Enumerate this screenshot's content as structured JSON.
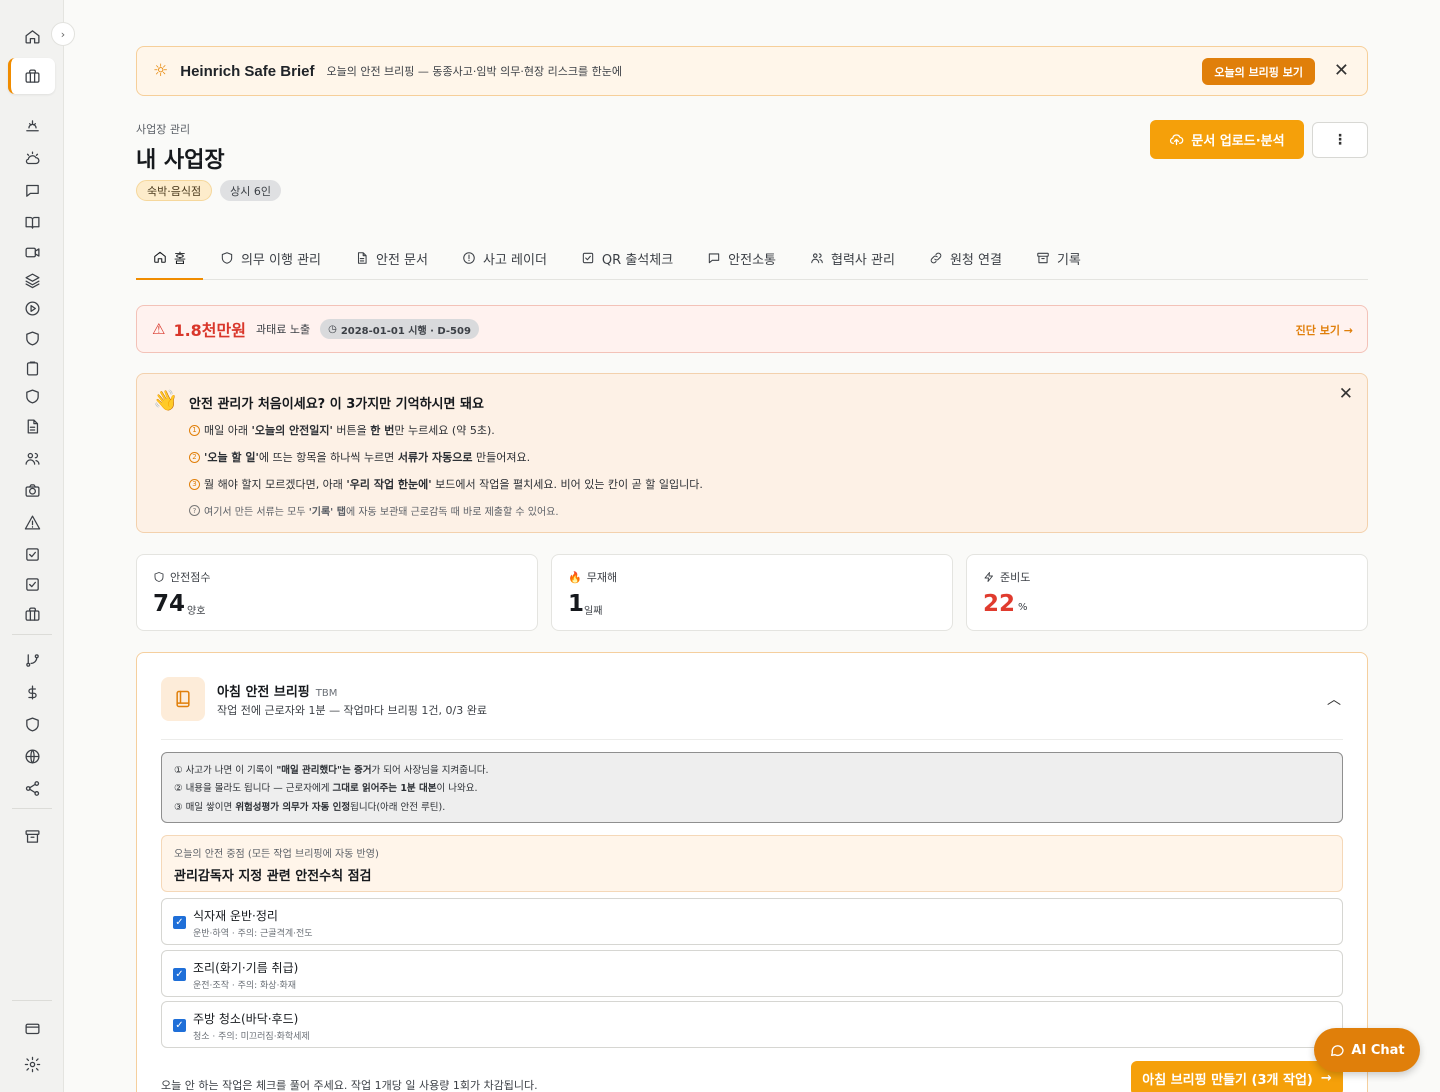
{
  "brief": {
    "title": "Heinrich Safe Brief",
    "description": "오늘의 안전 브리핑 — 동종사고·임박 의무·현장 리스크를 한눈에",
    "button": "오늘의 브리핑 보기",
    "close": "✕"
  },
  "header": {
    "breadcrumb": "사업장 관리",
    "title": "내 사업장",
    "tags": [
      "숙박·음식점",
      "상시 6인"
    ],
    "upload_button": "문서 업로드·분석",
    "more": "⋮"
  },
  "tabs": [
    "홈",
    "의무 이행 관리",
    "안전 문서",
    "사고 레이더",
    "QR 출석체크",
    "안전소통",
    "협력사 관리",
    "원청 연결",
    "기록"
  ],
  "penalty": {
    "amount": "1.8천만원",
    "label": "과태료 노출",
    "date_pill": "2028-01-01 시행 · D-509",
    "link": "진단 보기 →"
  },
  "onboarding": {
    "title": "안전 관리가 처음이세요? 이 3가지만 기억하시면 돼요",
    "steps": [
      {
        "num": "1",
        "pre": "매일 아래 ",
        "b1": "'오늘의 안전일지'",
        "mid": " 버튼을 ",
        "b2": "한 번",
        "post": "만 누르세요 (약 5초)."
      },
      {
        "num": "2",
        "pre": "",
        "b1": "'오늘 할 일'",
        "mid": "에 뜨는 항목을 하나씩 누르면 ",
        "b2": "서류가 자동으로",
        "post": " 만들어져요."
      },
      {
        "num": "3",
        "pre": "뭘 해야 할지 모르겠다면, 아래 ",
        "b1": "'우리 작업 한눈에'",
        "mid": " 보드에서 작업을 펼치세요. 비어 있는 칸이 곧 할 일입니다.",
        "b2": "",
        "post": ""
      }
    ],
    "note": {
      "num": "?",
      "pre": "여기서 만든 서류는 모두 ",
      "b1": "'기록' 탭",
      "post": "에 자동 보관돼 근로감독 때 바로 제출할 수 있어요."
    }
  },
  "stats": [
    {
      "label": "안전점수",
      "value": "74",
      "unit": "양호",
      "color": "#16191d"
    },
    {
      "label": "무재해",
      "value": "1",
      "unit": "일째",
      "color": "#16191d"
    },
    {
      "label": "준비도",
      "value": "22",
      "unit": "%",
      "color": "#e03b2e"
    }
  ],
  "tbm": {
    "title": "아침 안전 브리핑",
    "code": "TBM",
    "subtitle": "작업 전에 근로자와 1분 — 작업마다 브리핑 1건, 0/3 완료",
    "info": [
      {
        "num": "①",
        "pre": "사고가 나면 이 기록이 ",
        "b": "\"매일 관리했다\"는 증거",
        "post": "가 되어 사장님을 지켜줍니다."
      },
      {
        "num": "②",
        "pre": "내용을 몰라도 됩니다 — 근로자에게 ",
        "b": "그대로 읽어주는 1분 대본",
        "post": "이 나와요."
      },
      {
        "num": "③",
        "pre": "매일 쌓이면 ",
        "b": "위험성평가 의무가 자동 인정",
        "post": "됩니다(아래 안전 루틴)."
      }
    ],
    "focus_label": "오늘의 안전 중점 (모든 작업 브리핑에 자동 반영)",
    "focus_text": "관리감독자 지정 관련 안전수칙 점검",
    "tasks": [
      {
        "name": "식자재 운반·정리",
        "meta": "운반·하역 · 주의: 근골격계·전도",
        "checked": true
      },
      {
        "name": "조리(화기·기름 취급)",
        "meta": "운전·조작 · 주의: 화상·화재",
        "checked": true
      },
      {
        "name": "주방 청소(바닥·후드)",
        "meta": "청소 · 주의: 미끄러짐·화학세제",
        "checked": true
      }
    ],
    "footer": "오늘 안 하는 작업은 체크를 풀어 주세요. 작업 1개당 일 사용량 1회가 차감됩니다.",
    "make_button": "아침 브리핑 만들기 (3개 작업)"
  },
  "ai_chat": "AI Chat"
}
